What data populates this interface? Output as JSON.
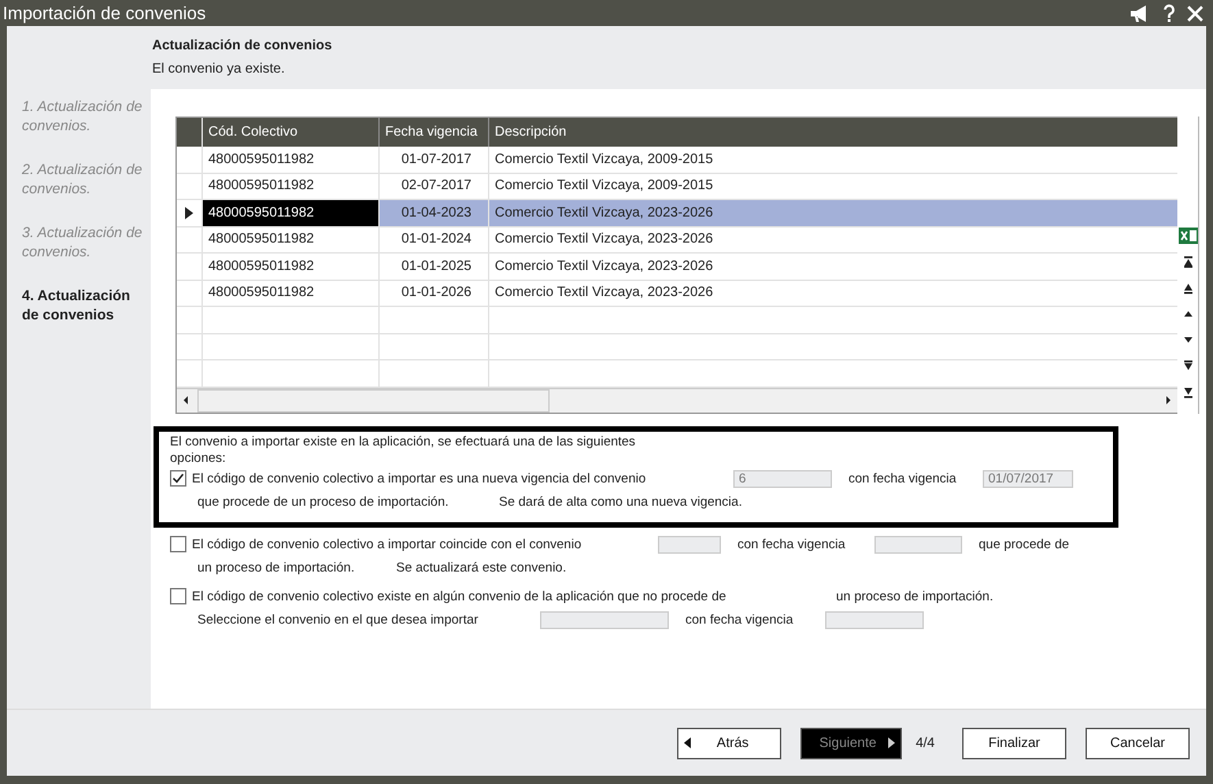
{
  "window": {
    "title": "Importación de convenios"
  },
  "header": {
    "title": "Actualización de convenios",
    "subtitle": "El convenio ya existe."
  },
  "steps": [
    {
      "label": "1. Actualización de convenios.",
      "selected": false
    },
    {
      "label": "2. Actualización de convenios.",
      "selected": false
    },
    {
      "label": "3. Actualización de convenios.",
      "selected": false
    },
    {
      "label": "4. Actualización de convenios",
      "selected": true
    }
  ],
  "table": {
    "columns": [
      "Cód. Colectivo",
      "Fecha vigencia",
      "Descripción"
    ],
    "rows": [
      {
        "cells": [
          "48000595011982",
          "01-07-2017",
          "Comercio Textil Vizcaya, 2009-2015"
        ],
        "selected": false
      },
      {
        "cells": [
          "48000595011982",
          "02-07-2017",
          "Comercio Textil Vizcaya, 2009-2015"
        ],
        "selected": false
      },
      {
        "cells": [
          "48000595011982",
          "01-04-2023",
          "Comercio Textil Vizcaya, 2023-2026"
        ],
        "selected": true
      },
      {
        "cells": [
          "48000595011982",
          "01-01-2024",
          "Comercio Textil Vizcaya, 2023-2026"
        ],
        "selected": false
      },
      {
        "cells": [
          "48000595011982",
          "01-01-2025",
          "Comercio Textil Vizcaya, 2023-2026"
        ],
        "selected": false
      },
      {
        "cells": [
          "48000595011982",
          "01-01-2026",
          "Comercio Textil Vizcaya, 2023-2026"
        ],
        "selected": false
      }
    ]
  },
  "options_intro": "El convenio a importar existe en la aplicación, se efectuará una de las siguientes opciones:",
  "options": [
    {
      "checked": true,
      "lines": [
        [
          {
            "kind": "text",
            "text": "El código de convenio colectivo a importar es una nueva vigencia del convenio"
          },
          {
            "kind": "field",
            "value": "6"
          },
          {
            "kind": "text",
            "text": "con fecha vigencia"
          },
          {
            "kind": "field",
            "value": "01/07/2017"
          }
        ],
        [
          {
            "kind": "text",
            "text": "que procede de un proceso de importación."
          },
          {
            "kind": "text",
            "text": "Se dará de alta como una nueva vigencia."
          }
        ]
      ]
    },
    {
      "checked": false,
      "lines": [
        [
          {
            "kind": "text",
            "text": "El código de convenio colectivo a importar coincide con el convenio"
          },
          {
            "kind": "field"
          },
          {
            "kind": "text",
            "text": "con fecha vigencia"
          },
          {
            "kind": "field"
          },
          {
            "kind": "text",
            "text": "que procede de"
          }
        ],
        [
          {
            "kind": "text",
            "text": "un proceso de importación."
          },
          {
            "kind": "text",
            "text": "Se actualizará este convenio."
          }
        ]
      ]
    },
    {
      "checked": false,
      "lines": [
        [
          {
            "kind": "text",
            "text": "El código de convenio colectivo existe en algún convenio de la aplicación que no procede de"
          },
          {
            "kind": "text",
            "text": "un proceso de importación."
          }
        ],
        [
          {
            "kind": "text",
            "text": "Seleccione el convenio en el que desea importar"
          },
          {
            "kind": "field"
          },
          {
            "kind": "text",
            "text": "con fecha vigencia"
          },
          {
            "kind": "field"
          }
        ]
      ]
    }
  ],
  "footer": {
    "buttons": [
      {
        "label": "Atrás",
        "kind": "back",
        "disabled": false
      },
      {
        "label": "Siguiente",
        "kind": "next",
        "disabled": true
      }
    ],
    "page": "4/4",
    "actions": [
      "Finalizar",
      "Cancelar"
    ]
  }
}
